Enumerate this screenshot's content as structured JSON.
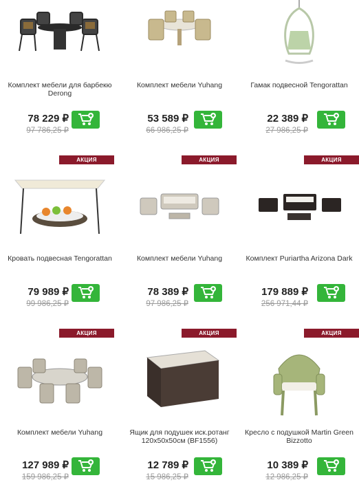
{
  "currency": "₽",
  "badge_label": "АКЦИЯ",
  "colors": {
    "badge": "#8b1a2b",
    "cart_button": "#34b53a",
    "old_price": "#9a9a9a"
  },
  "products": [
    {
      "title": "Комплект мебели для барбекю Derong",
      "price": "78 229 ₽",
      "old_price": "97 786,25 ₽",
      "badge": "",
      "image_icon": "bbq-dining-set-icon"
    },
    {
      "title": "Комплект мебели Yuhang",
      "price": "53 589 ₽",
      "old_price": "66 986,25 ₽",
      "badge": "",
      "image_icon": "rattan-dining-set-icon"
    },
    {
      "title": "Гамак подвесной Tengorattan",
      "price": "22 389 ₽",
      "old_price": "27 986,25 ₽",
      "badge": "",
      "image_icon": "hanging-hammock-chair-icon"
    },
    {
      "title": "Кровать подвесная Tengorattan",
      "price": "79 989 ₽",
      "old_price": "99 986,25 ₽",
      "badge": "АКЦИЯ",
      "image_icon": "hanging-bed-icon"
    },
    {
      "title": "Комплект мебели Yuhang",
      "price": "78 389 ₽",
      "old_price": "97 986,25 ₽",
      "badge": "АКЦИЯ",
      "image_icon": "rattan-lounge-set-icon"
    },
    {
      "title": "Комплект Puriartha Arizona Dark",
      "price": "179 889 ₽",
      "old_price": "256 971,44 ₽",
      "badge": "АКЦИЯ",
      "image_icon": "dark-lounge-set-icon"
    },
    {
      "title": "Комплект мебели Yuhang",
      "price": "127 989 ₽",
      "old_price": "159 986,25 ₽",
      "badge": "АКЦИЯ",
      "image_icon": "round-dining-set-icon"
    },
    {
      "title": "Ящик для подушек иск.ротанг 120x50x50см (BF1556)",
      "price": "12 789 ₽",
      "old_price": "15 986,25 ₽",
      "badge": "АКЦИЯ",
      "image_icon": "cushion-box-icon"
    },
    {
      "title": "Кресло с подушкой Martin Green Bizzotto",
      "price": "10 389 ₽",
      "old_price": "12 986,25 ₽",
      "badge": "АКЦИЯ",
      "image_icon": "green-armchair-icon"
    }
  ]
}
